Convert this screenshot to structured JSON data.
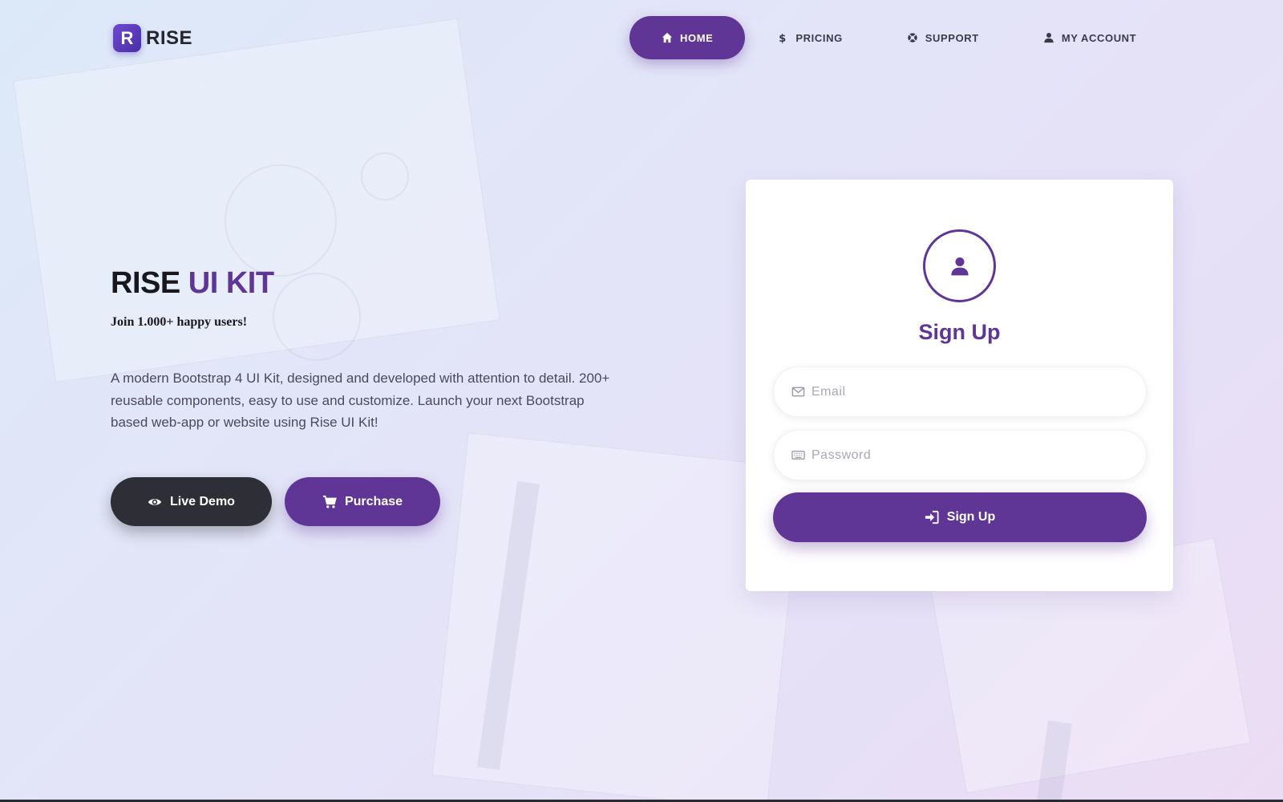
{
  "brand": {
    "logo_letter": "R",
    "name": "RISE"
  },
  "nav": {
    "items": [
      {
        "label": "HOME",
        "icon": "home-icon",
        "active": true
      },
      {
        "label": "PRICING",
        "icon": "dollar-icon",
        "active": false
      },
      {
        "label": "SUPPORT",
        "icon": "lifebuoy-icon",
        "active": false
      },
      {
        "label": "MY ACCOUNT",
        "icon": "user-icon",
        "active": false
      }
    ]
  },
  "hero": {
    "title_part1": "RISE",
    "title_part2": "UI KIT",
    "subtitle": "Join 1.000+ happy users!",
    "description": "A modern Bootstrap 4 UI Kit, designed and developed with attention to detail. 200+ reusable components, easy to use and customize. Launch your next Bootstrap based web-app or website using Rise UI Kit!",
    "demo_label": "Live Demo",
    "purchase_label": "Purchase"
  },
  "signup": {
    "title": "Sign Up",
    "email_placeholder": "Email",
    "password_placeholder": "Password",
    "button_label": "Sign Up"
  },
  "colors": {
    "accent": "#5f3595",
    "dark_button": "#2e2e36",
    "background_start": "#dce9f8",
    "background_end": "#ecdcf3"
  }
}
